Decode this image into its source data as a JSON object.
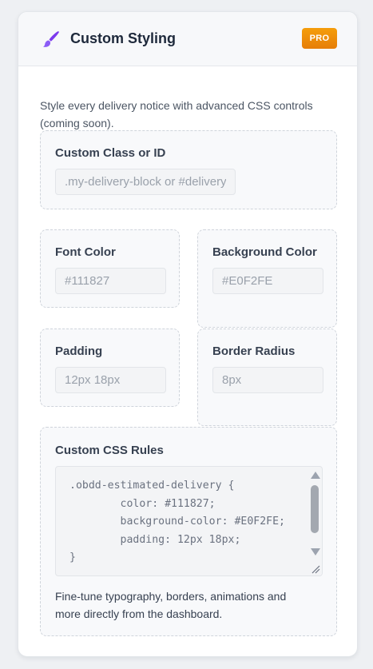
{
  "header": {
    "title": "Custom Styling",
    "badge": "PRO",
    "icon": "paintbrush-icon",
    "icon_color": "#7c3aed",
    "badge_color": "#f59e0b"
  },
  "intro": "Style every delivery notice with advanced CSS controls (coming soon).",
  "fields": {
    "custom_class": {
      "label": "Custom Class or ID",
      "placeholder": ".my-delivery-block or #delivery-block"
    },
    "font_color": {
      "label": "Font Color",
      "placeholder": "#111827"
    },
    "background_color": {
      "label": "Background Color",
      "placeholder": "#E0F2FE"
    },
    "padding": {
      "label": "Padding",
      "placeholder": "12px 18px"
    },
    "border_radius": {
      "label": "Border Radius",
      "placeholder": "8px"
    }
  },
  "css_rules": {
    "label": "Custom CSS Rules",
    "code": ".obdd-estimated-delivery {\n        color: #111827;\n        background-color: #E0F2FE;\n        padding: 12px 18px;\n}",
    "help": "Fine-tune typography, borders, animations and more directly from the dashboard."
  }
}
